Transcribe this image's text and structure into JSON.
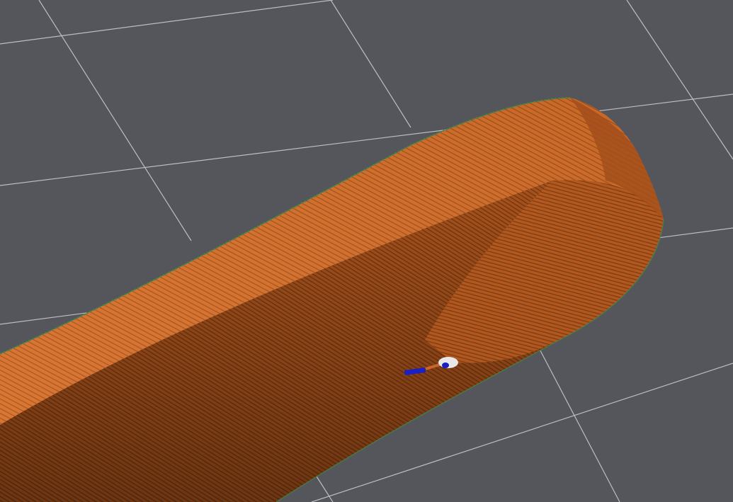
{
  "viewport": {
    "background_color": "#55565c",
    "grid_line_color": "#c8c9cd",
    "grid_visible": true
  },
  "model": {
    "top_color": "#d8702a",
    "side_color": "#a44f1a",
    "shadow_color": "#7a3810",
    "layer_line_color": "#7a3d12",
    "outline_color": "#3f8a4a",
    "toolpath_visible": true
  },
  "toolhead": {
    "nozzle_color": "#e8e8e8",
    "travel_color": "#1b1fc4"
  }
}
